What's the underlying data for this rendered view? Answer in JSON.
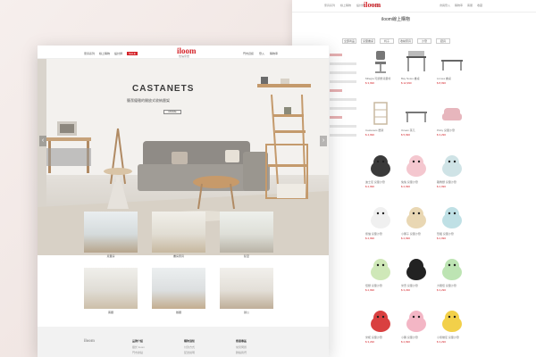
{
  "shop": {
    "logo": "iloom",
    "title": "iloom線上購物",
    "nav_left": [
      "家具系列",
      "線上購物",
      "設計師",
      "門市資訊"
    ],
    "nav_right": [
      "會員登入",
      "購物車",
      "客服",
      "收藏"
    ],
    "categories": [
      "全部商品",
      "兒童書桌",
      "椅子",
      "收納家具",
      "沙發",
      "寢具"
    ],
    "products": [
      {
        "name": "Milegia 可調整兒童椅",
        "price": "$ 3,990"
      },
      {
        "name": "Bay Notes 書桌",
        "price": "$ 12,990"
      },
      {
        "name": "Linnea 書桌",
        "price": "$ 8,990"
      },
      {
        "name": "Castanets 層架",
        "price": "$ 4,990"
      },
      {
        "name": "Ocean 茶几",
        "price": "$ 5,990"
      },
      {
        "name": "Picky 兒童沙發",
        "price": "$ 3,290"
      },
      {
        "name": "迪士尼 兒童沙發",
        "price": "$ 2,990"
      },
      {
        "name": "兔兔 兒童沙發",
        "price": "$ 2,990"
      },
      {
        "name": "獨角獸 兒童沙發",
        "price": "$ 2,990"
      },
      {
        "name": "熊貓 兒童沙發",
        "price": "$ 2,990"
      },
      {
        "name": "小獅子 兒童沙發",
        "price": "$ 2,990"
      },
      {
        "name": "恐龍 兒童沙發",
        "price": "$ 2,990"
      },
      {
        "name": "怪獸 兒童沙發",
        "price": "$ 2,990"
      },
      {
        "name": "米奇 兒童沙發",
        "price": "$ 3,290"
      },
      {
        "name": "大眼怪 兒童沙發",
        "price": "$ 3,290"
      },
      {
        "name": "米妮 兒童沙發",
        "price": "$ 3,290"
      },
      {
        "name": "小豬 兒童沙發",
        "price": "$ 2,990"
      },
      {
        "name": "小熊維尼 兒童沙發",
        "price": "$ 3,290"
      }
    ]
  },
  "front": {
    "logo": "iloom",
    "logo_sub": "怡倫家居",
    "nav_left": [
      "家具系列",
      "線上購物",
      "設計師"
    ],
    "badge": "SALE",
    "nav_right": [
      "門市資訊",
      "登入",
      "購物車"
    ],
    "hero": {
      "title": "CASTANETS",
      "subtitle": "簡潔優雅的開放式收納層架",
      "button": "MORE"
    },
    "cards": [
      "兒童房",
      "書房家具",
      "臥室",
      "客廳",
      "餐廳",
      "辦公"
    ],
    "footer": {
      "brand": "iloom",
      "col1": {
        "title": "品牌介紹",
        "links": [
          "關於 iloom",
          "門市據點"
        ]
      },
      "col2": {
        "title": "購物須知",
        "links": [
          "付款方式",
          "配送說明"
        ]
      },
      "col3": {
        "title": "客服專區",
        "links": [
          "常見問題",
          "聯絡我們"
        ]
      }
    }
  },
  "colors": {
    "brand_red": "#d4242a",
    "bg_pink": "#f1e9e7"
  }
}
